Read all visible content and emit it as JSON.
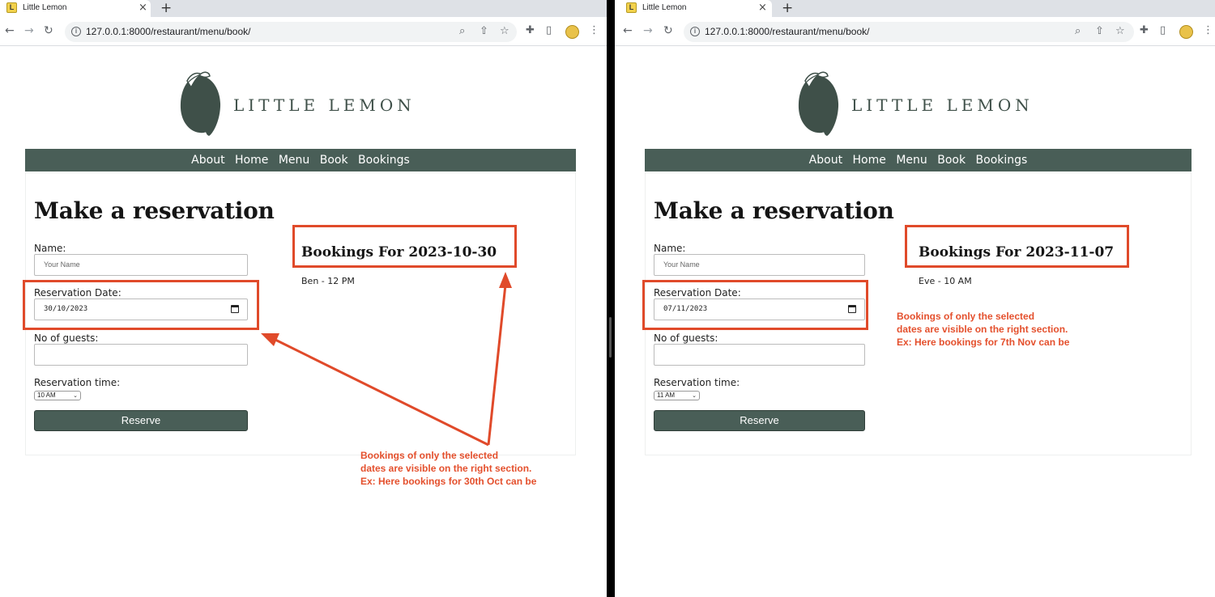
{
  "left": {
    "tab_title": "Little Lemon",
    "url": "127.0.0.1:8000/restaurant/menu/book/",
    "logo_text": "LITTLE LEMON",
    "nav": [
      "About",
      "Home",
      "Menu",
      "Book",
      "Bookings"
    ],
    "heading": "Make a reservation",
    "name_label": "Name:",
    "name_placeholder": "Your Name",
    "date_label": "Reservation Date:",
    "date_value": "30/10/2023",
    "guests_label": "No of guests:",
    "time_label": "Reservation time:",
    "time_value": "10 AM",
    "reserve_label": "Reserve",
    "bookings_title": "Bookings For 2023-10-30",
    "bookings": [
      "Ben - 12 PM"
    ],
    "note": [
      "Bookings of only the selected",
      "dates are visible on the right section.",
      "Ex: Here bookings for 30th Oct can be"
    ]
  },
  "right": {
    "tab_title": "Little Lemon",
    "url": "127.0.0.1:8000/restaurant/menu/book/",
    "logo_text": "LITTLE LEMON",
    "nav": [
      "About",
      "Home",
      "Menu",
      "Book",
      "Bookings"
    ],
    "heading": "Make a reservation",
    "name_label": "Name:",
    "name_placeholder": "Your Name",
    "date_label": "Reservation Date:",
    "date_value": "07/11/2023",
    "guests_label": "No of guests:",
    "time_label": "Reservation time:",
    "time_value": "11 AM",
    "reserve_label": "Reserve",
    "bookings_title": "Bookings For 2023-11-07",
    "bookings": [
      "Eve - 10 AM"
    ],
    "note": [
      "Bookings of only the selected",
      "dates are visible on the right section.",
      "Ex: Here bookings for 7th Nov can be"
    ]
  },
  "colors": {
    "brand_green": "#495e57",
    "annotation_red": "#e04a2a"
  },
  "icons": {
    "favicon": "lemon-favicon-icon",
    "back": "back-arrow-icon",
    "forward": "forward-arrow-icon",
    "reload": "reload-icon",
    "site_info": "info-icon",
    "zoom": "zoom-icon",
    "share": "share-icon",
    "bookmark": "star-icon",
    "extensions": "puzzle-icon",
    "sidepanel": "side-panel-icon",
    "menu": "kebab-menu-icon",
    "calendar": "calendar-icon"
  }
}
